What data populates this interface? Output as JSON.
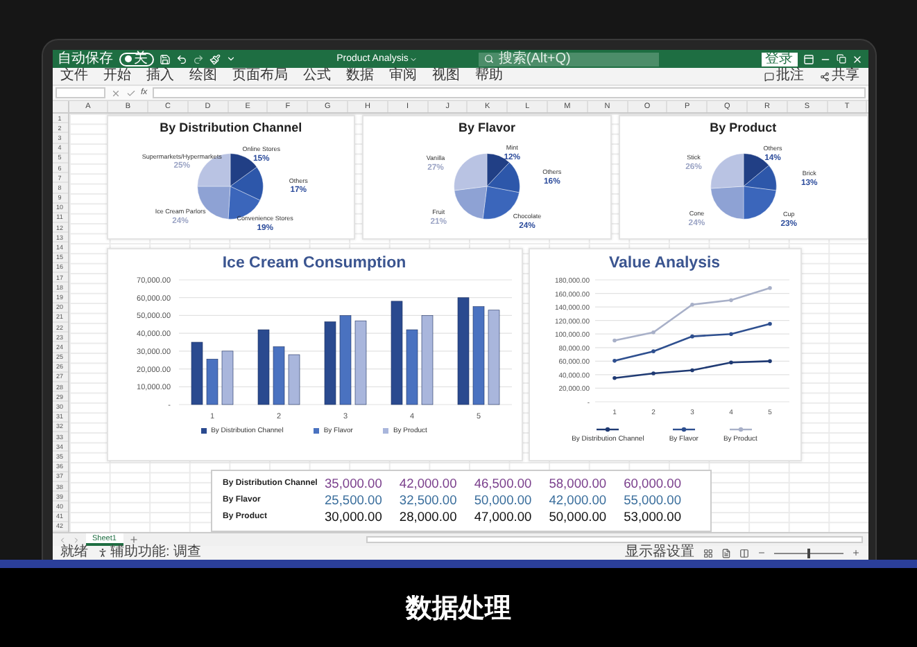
{
  "title_bar": {
    "autosave_label": "自动保存",
    "autosave_on": false,
    "autosave_state": "关",
    "document_title": "Product Analysis",
    "search": {
      "placeholder": "搜索(Alt+Q)"
    },
    "sign_in": "登录"
  },
  "ribbon_tabs": [
    "文件",
    "开始",
    "插入",
    "绘图",
    "页面布局",
    "公式",
    "数据",
    "审阅",
    "视图",
    "帮助"
  ],
  "ribbon_actions": [
    "批注",
    "共享"
  ],
  "formula_bar": {
    "function_label": "fx"
  },
  "columns": [
    "A",
    "B",
    "C",
    "D",
    "E",
    "F",
    "G",
    "H",
    "I",
    "J",
    "K",
    "L",
    "M",
    "N",
    "O",
    "P",
    "Q",
    "R",
    "S",
    "T"
  ],
  "row_numbers": [
    "1",
    "2",
    "3",
    "4",
    "5",
    "6",
    "7",
    "8",
    "9",
    "10",
    "11",
    "12",
    "13",
    "14",
    "15",
    "16",
    "17",
    "18",
    "19",
    "20",
    "21",
    "22",
    "23",
    "24",
    "25",
    "26",
    "27",
    "28",
    "29",
    "30",
    "31",
    "32",
    "33",
    "34",
    "35",
    "36",
    "37",
    "38",
    "39",
    "40",
    "41",
    "42"
  ],
  "pie_charts": [
    {
      "chart_data": {
        "type": "pie",
        "title": "By Distribution Channel",
        "categories": [
          "Online Stores",
          "Others",
          "Convenience Stores",
          "Ice Cream Parlors",
          "Supermarkets/Hypermarkets"
        ],
        "values": [
          15,
          17,
          19,
          24,
          25
        ],
        "value_labels": [
          "15%",
          "17%",
          "19%",
          "24%",
          "25%"
        ]
      }
    },
    {
      "chart_data": {
        "type": "pie",
        "title": "By Flavor",
        "categories": [
          "Mint",
          "Others",
          "Chocolate",
          "Fruit",
          "Vanilla"
        ],
        "values": [
          12,
          16,
          24,
          21,
          27
        ],
        "value_labels": [
          "12%",
          "16%",
          "24%",
          "21%",
          "27%"
        ]
      }
    },
    {
      "chart_data": {
        "type": "pie",
        "title": "By Product",
        "categories": [
          "Others",
          "Brick",
          "Cup",
          "Cone",
          "Stick"
        ],
        "values": [
          14,
          13,
          23,
          24,
          26
        ],
        "value_labels": [
          "14%",
          "13%",
          "23%",
          "24%",
          "26%"
        ]
      }
    }
  ],
  "bar_chart": {
    "chart_data": {
      "type": "bar",
      "title": "Ice Cream Consumption",
      "categories": [
        "1",
        "2",
        "3",
        "4",
        "5"
      ],
      "series": [
        {
          "name": "By Distribution Channel",
          "color": "#2a4a8f",
          "values": [
            35000,
            42000,
            46500,
            58000,
            60000
          ]
        },
        {
          "name": "By Flavor",
          "color": "#4a72c0",
          "values": [
            25500,
            32500,
            50000,
            42000,
            55000
          ]
        },
        {
          "name": "By Product",
          "color": "#a9b6dc",
          "values": [
            30000,
            28000,
            47000,
            50000,
            53000
          ]
        }
      ],
      "grid": true,
      "legend": "bottom",
      "ylim": [
        0,
        70000
      ],
      "yticks": [
        {
          "value": 0,
          "label": "-"
        },
        {
          "value": 10000,
          "label": "10,000.00"
        },
        {
          "value": 20000,
          "label": "20,000.00"
        },
        {
          "value": 30000,
          "label": "30,000.00"
        },
        {
          "value": 40000,
          "label": "40,000.00"
        },
        {
          "value": 50000,
          "label": "50,000.00"
        },
        {
          "value": 60000,
          "label": "60,000.00"
        },
        {
          "value": 70000,
          "label": "70,000.00"
        }
      ]
    }
  },
  "line_chart": {
    "chart_data": {
      "type": "line",
      "title": "Value Analysis",
      "categories": [
        "1",
        "2",
        "3",
        "4",
        "5"
      ],
      "series": [
        {
          "name": "By Distribution Channel",
          "color": "#1f3a73",
          "values": [
            35000,
            42000,
            46500,
            58000,
            60000
          ]
        },
        {
          "name": "By Flavor",
          "color": "#2e4f8f",
          "values": [
            60500,
            74500,
            96500,
            100000,
            115000
          ]
        },
        {
          "name": "By Product",
          "color": "#a8b0c8",
          "values": [
            90500,
            102500,
            143500,
            150000,
            168000
          ]
        }
      ],
      "grid": true,
      "legend": "bottom",
      "ylim": [
        0,
        180000
      ],
      "yticks": [
        {
          "value": 0,
          "label": "-"
        },
        {
          "value": 20000,
          "label": "20,000.00"
        },
        {
          "value": 40000,
          "label": "40,000.00"
        },
        {
          "value": 60000,
          "label": "60,000.00"
        },
        {
          "value": 80000,
          "label": "80,000.00"
        },
        {
          "value": 100000,
          "label": "100,000.00"
        },
        {
          "value": 120000,
          "label": "120,000.00"
        },
        {
          "value": 140000,
          "label": "140,000.00"
        },
        {
          "value": 160000,
          "label": "160,000.00"
        },
        {
          "value": 180000,
          "label": "180,000.00"
        }
      ]
    }
  },
  "data_table": {
    "rows": [
      {
        "label": "By Distribution Channel",
        "color": "#7a3f8c",
        "values": [
          "35,000.00",
          "42,000.00",
          "46,500.00",
          "58,000.00",
          "60,000.00"
        ]
      },
      {
        "label": "By Flavor",
        "color": "#3a6e9c",
        "values": [
          "25,500.00",
          "32,500.00",
          "50,000.00",
          "42,000.00",
          "55,000.00"
        ]
      },
      {
        "label": "By Product",
        "color": "#111111",
        "values": [
          "30,000.00",
          "28,000.00",
          "47,000.00",
          "50,000.00",
          "53,000.00"
        ]
      }
    ]
  },
  "sheet_tabs": [
    {
      "label": "Sheet1",
      "selected": true
    }
  ],
  "status_bar": {
    "ready": "就绪",
    "accessibility": "辅助功能: 调查",
    "display_settings": "显示器设置"
  },
  "zoom": {
    "level": 0.5
  },
  "caption": "数据处理"
}
